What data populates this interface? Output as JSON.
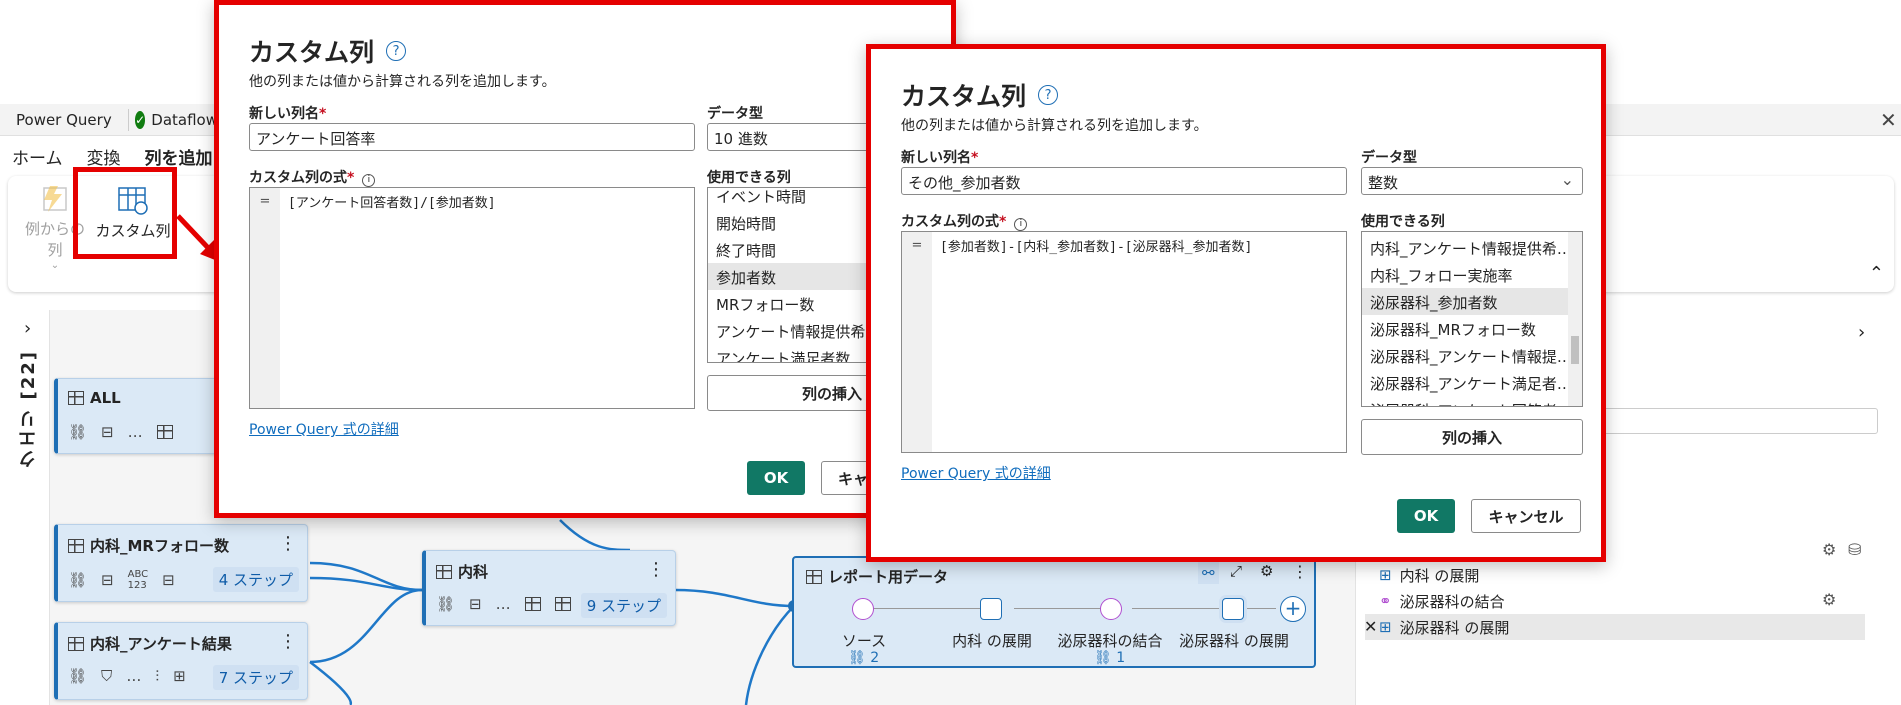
{
  "app": {
    "title": "Power Query",
    "dataflow_label": "Dataflow",
    "close_glyph": "✕"
  },
  "ribbon": {
    "tabs": [
      "ホーム",
      "変換",
      "列を追加し"
    ],
    "from_example_label": "例からの列",
    "custom_column_label": "カスタム列",
    "collapse_glyph": "⌃"
  },
  "queries_panel": {
    "label": "クエリ [22]",
    "expand_glyph": "›"
  },
  "queries": [
    {
      "name": "ALL",
      "steps": ""
    },
    {
      "name": "内科_MRフォロー数",
      "steps": "4 ステップ",
      "abc": "ABC\n123"
    },
    {
      "name": "内科_アンケート結果",
      "steps": "7 ステップ"
    },
    {
      "name": "内科",
      "steps": "9 ステップ"
    }
  ],
  "report_node": {
    "title": "レポート用データ",
    "steps": [
      "ソース",
      "内科 の展開",
      "泌尿器科の結合",
      "泌尿器科 の展開"
    ],
    "counts": [
      "2",
      "1"
    ],
    "add_glyph": "+"
  },
  "applied_steps": [
    {
      "label": "内科 の展開"
    },
    {
      "label": "泌尿器科の結合"
    },
    {
      "label": "泌尿器科 の展開"
    }
  ],
  "dialog1": {
    "title": "カスタム列",
    "subtitle": "他の列または値から計算される列を追加します。",
    "new_col_label": "新しい列名",
    "new_col_value": "アンケート回答率",
    "data_type_label": "データ型",
    "data_type_value": "10 進数",
    "formula_label": "カスタム列の式",
    "formula_gutter": "=",
    "formula": "[アンケート回答者数]/[参加者数]",
    "available_label": "使用できる列",
    "columns": [
      "イベント時間",
      "開始時間",
      "終了時間",
      "参加者数",
      "MRフォロー数",
      "アンケート情報提供希望",
      "アンケート満足者数"
    ],
    "insert_label": "列の挿入",
    "link": "Power Query 式の詳細",
    "ok": "OK",
    "cancel": "キャ"
  },
  "dialog2": {
    "title": "カスタム列",
    "subtitle": "他の列または値から計算される列を追加します。",
    "new_col_label": "新しい列名",
    "new_col_value": "その他_参加者数",
    "data_type_label": "データ型",
    "data_type_value": "整数",
    "formula_label": "カスタム列の式",
    "formula_gutter": "=",
    "formula": "[参加者数]-[内科_参加者数]-[泌尿器科_参加者数]",
    "available_label": "使用できる列",
    "columns": [
      "内科_アンケート情報提供希…",
      "内科_フォロー実施率",
      "泌尿器科_参加者数",
      "泌尿器科_MRフォロー数",
      "泌尿器科_アンケート情報提…",
      "泌尿器科_アンケート満足者…",
      "泌尿器科_アンケート回答者…"
    ],
    "insert_label": "列の挿入",
    "link": "Power Query 式の詳細",
    "ok": "OK",
    "cancel": "キャンセル"
  },
  "colors": {
    "highlight_red": "#e50000",
    "ok_green": "#117865",
    "node_blue": "#1f6fb5",
    "card_bg": "#dbe9f6"
  }
}
